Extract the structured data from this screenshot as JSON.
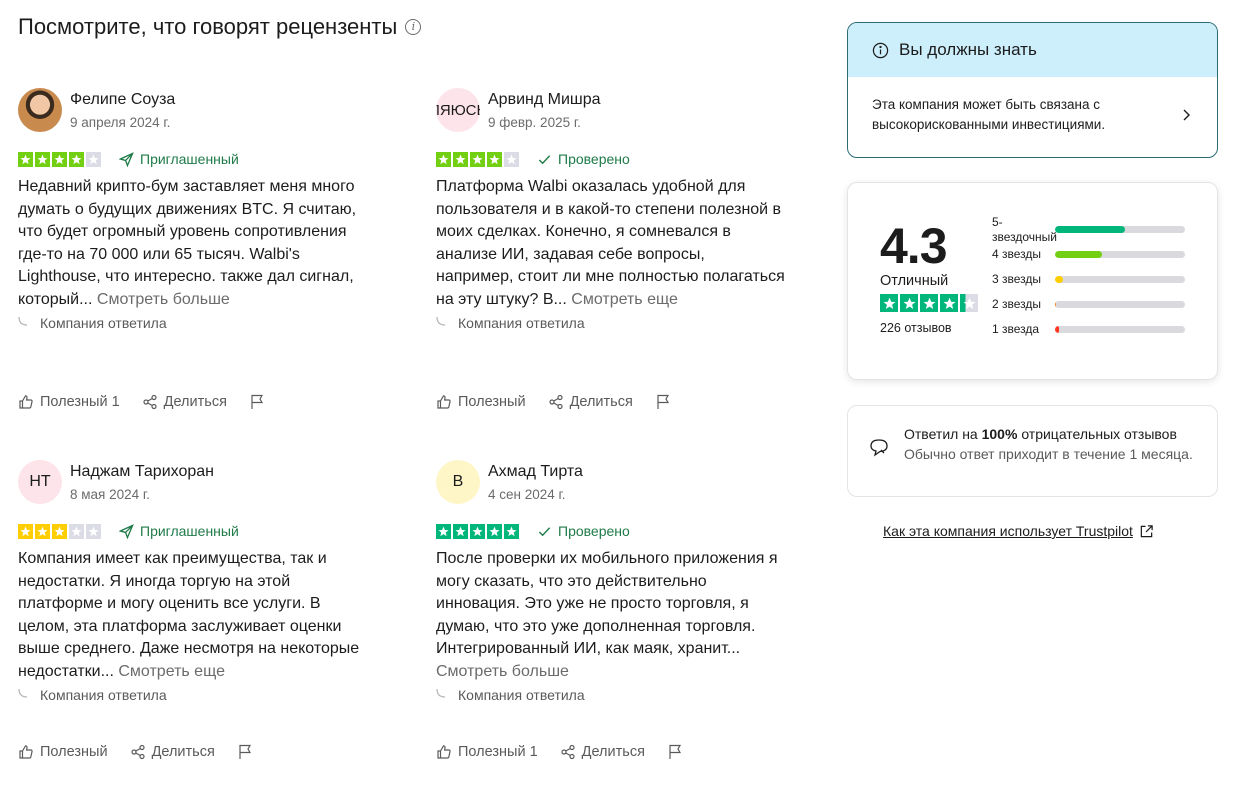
{
  "section": {
    "title": "Посмотрите, что говорят рецензенты",
    "info_icon": "info-icon"
  },
  "colors": {
    "star_green": "#00b67a",
    "star_lime": "#73cf11",
    "star_yellow": "#ffce00",
    "star_empty": "#dcdce6",
    "bar_red": "#ff3722",
    "verified_green": "#1e7b48"
  },
  "reviews": [
    {
      "avatar": "",
      "name": "Фелипе Соуза",
      "date": "9 апреля 2024 г.",
      "stars": 4,
      "badge": "Приглашенный",
      "text": "Недавний крипто-бум заставляет меня много думать о будущих движениях BTC. Я считаю, что будет огромный уровень сопротивления где-то на 70 000 или 65 тысяч. Walbi's Lighthouse, что интересно. также дал сигнал, который...",
      "more": "Смотреть больше",
      "reply": "Компания ответила",
      "helpful": "Полезный 1",
      "share": "Делиться"
    },
    {
      "avatar": "ЛЯЮСЬ",
      "name": "Арвинд Мишра",
      "date": "9 февр. 2025 г.",
      "stars": 4,
      "badge": "Проверено",
      "text": "Платформа Walbi оказалась удобной для пользователя и в какой-то степени полезной в моих сделках. Конечно, я сомневался в анализе ИИ, задавая себе вопросы, например, стоит ли мне полностью полагаться на эту штуку? В...",
      "more": "Смотреть еще",
      "reply": "Компания ответила",
      "helpful": "Полезный",
      "share": "Делиться"
    },
    {
      "avatar": "НТ",
      "name": "Наджам Тарихоран",
      "date": "8 мая 2024 г.",
      "stars": 3,
      "badge": "Приглашенный",
      "text": "Компания имеет как преимущества, так и недостатки. Я иногда торгую на этой платформе и могу оценить все услуги. В целом, эта платформа заслуживает оценки выше среднего. Даже несмотря на некоторые недостатки...",
      "more": "Смотреть еще",
      "reply": "Компания ответила",
      "helpful": "Полезный",
      "share": "Делиться"
    },
    {
      "avatar": "В",
      "name": "Ахмад Тирта",
      "date": "4 сен 2024 г.",
      "stars": 5,
      "badge": "Проверено",
      "text": "После проверки их мобильного приложения я могу сказать, что это действительно инновация. Это уже не просто торговля, я думаю, что это уже дополненная торговля. Интегрированный ИИ, как маяк, хранит...",
      "more": "Смотреть больше",
      "reply": "Компания ответила",
      "helpful": "Полезный 1",
      "share": "Делиться"
    }
  ],
  "know": {
    "title": "Вы должны знать",
    "text_line1": "Эта компания может быть связана с",
    "text_line2": "высокорискованными инвестициями."
  },
  "score": {
    "value": "4.3",
    "label": "Отличный",
    "stars": 4.3,
    "count": "226 отзывов",
    "bars": [
      {
        "label": "5-звездочный",
        "fraction": 0.54,
        "color": "#00b67a"
      },
      {
        "label": "4 звезды",
        "fraction": 0.36,
        "color": "#73cf11"
      },
      {
        "label": "3 звезды",
        "fraction": 0.06,
        "color": "#ffce00"
      },
      {
        "label": "2 звезды",
        "fraction": 0.01,
        "color": "#ff8622"
      },
      {
        "label": "1 звезда",
        "fraction": 0.03,
        "color": "#ff3722"
      }
    ]
  },
  "replied": {
    "line1_prefix": "Ответил на",
    "line1_bold": "100%",
    "line1_suffix": "отрицательных отзывов",
    "line2": "Обычно ответ приходит в течение 1 месяца."
  },
  "trustpilot_link": "Как эта компания использует Trustpilot"
}
